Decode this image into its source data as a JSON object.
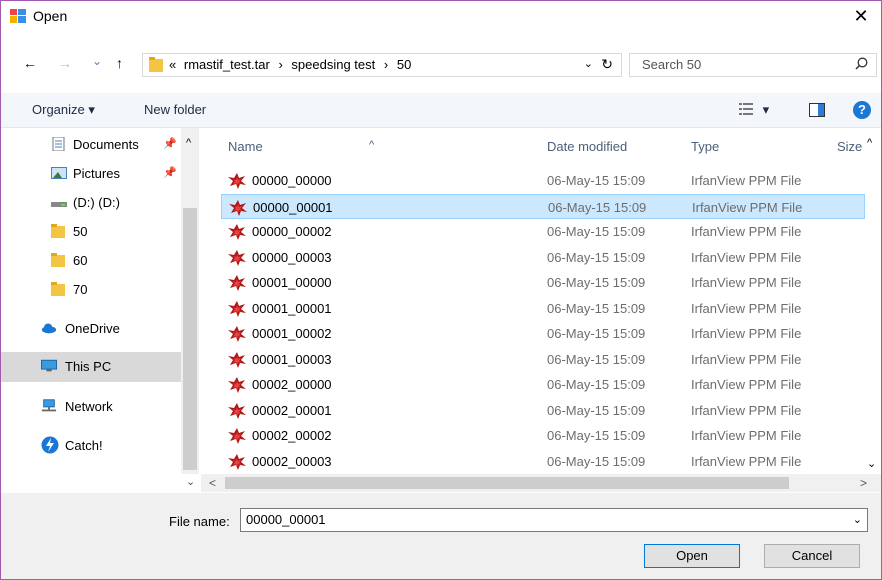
{
  "window": {
    "title": "Open",
    "close_glyph": "✕"
  },
  "nav": {
    "back_glyph": "←",
    "forward_glyph": "→",
    "recent_glyph": "⌄",
    "up_glyph": "↑",
    "crumb_prefix": "«",
    "crumbs": [
      "rmastif_test.tar",
      "speedsing test",
      "50"
    ],
    "crumb_sep": "›",
    "refresh_glyph": "↻",
    "search_placeholder": "Search 50"
  },
  "toolbar": {
    "organize": "Organize ▾",
    "new_folder": "New folder",
    "view_glyph": "▾",
    "help": "?"
  },
  "sidebar": {
    "items": [
      {
        "label": "Documents",
        "icon": "documents-icon",
        "pinned": true
      },
      {
        "label": "Pictures",
        "icon": "pictures-icon",
        "pinned": true
      },
      {
        "label": "(D:) (D:)",
        "icon": "drive-icon"
      },
      {
        "label": "50",
        "icon": "folder-icon"
      },
      {
        "label": "60",
        "icon": "folder-icon"
      },
      {
        "label": "70",
        "icon": "folder-icon"
      },
      {
        "label": "OneDrive",
        "icon": "onedrive-icon"
      },
      {
        "label": "This PC",
        "icon": "pc-icon",
        "selected": true
      },
      {
        "label": "Network",
        "icon": "network-icon"
      },
      {
        "label": "Catch!",
        "icon": "catch-icon"
      }
    ]
  },
  "columns": {
    "name": "Name",
    "date": "Date modified",
    "type": "Type",
    "size": "Size"
  },
  "files": [
    {
      "name": "00000_00000",
      "date": "06-May-15 15:09",
      "type": "IrfanView PPM File"
    },
    {
      "name": "00000_00001",
      "date": "06-May-15 15:09",
      "type": "IrfanView PPM File",
      "selected": true
    },
    {
      "name": "00000_00002",
      "date": "06-May-15 15:09",
      "type": "IrfanView PPM File"
    },
    {
      "name": "00000_00003",
      "date": "06-May-15 15:09",
      "type": "IrfanView PPM File"
    },
    {
      "name": "00001_00000",
      "date": "06-May-15 15:09",
      "type": "IrfanView PPM File"
    },
    {
      "name": "00001_00001",
      "date": "06-May-15 15:09",
      "type": "IrfanView PPM File"
    },
    {
      "name": "00001_00002",
      "date": "06-May-15 15:09",
      "type": "IrfanView PPM File"
    },
    {
      "name": "00001_00003",
      "date": "06-May-15 15:09",
      "type": "IrfanView PPM File"
    },
    {
      "name": "00002_00000",
      "date": "06-May-15 15:09",
      "type": "IrfanView PPM File"
    },
    {
      "name": "00002_00001",
      "date": "06-May-15 15:09",
      "type": "IrfanView PPM File"
    },
    {
      "name": "00002_00002",
      "date": "06-May-15 15:09",
      "type": "IrfanView PPM File"
    },
    {
      "name": "00002_00003",
      "date": "06-May-15 15:09",
      "type": "IrfanView PPM File"
    }
  ],
  "footer": {
    "file_name_label": "File name:",
    "file_name_value": "00000_00001",
    "open": "Open",
    "cancel": "Cancel"
  },
  "colors": {
    "selection": "#cce8ff",
    "accent": "#0078d7",
    "frame": "#a05ab0"
  }
}
